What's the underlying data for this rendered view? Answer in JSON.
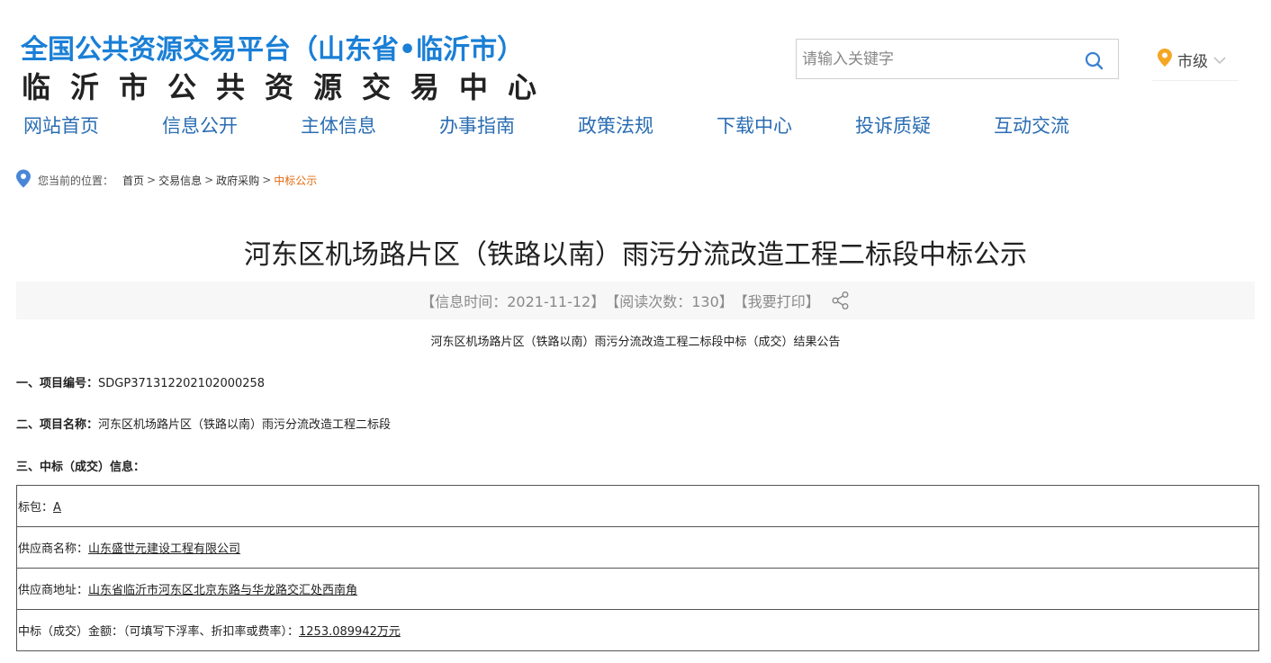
{
  "header": {
    "site_title": "全国公共资源交易平台（山东省•临沂市）",
    "site_subtitle": "临沂市公共资源交易中心"
  },
  "search": {
    "placeholder": "请输入关键字"
  },
  "region": {
    "label": "市级"
  },
  "nav": {
    "items": [
      "网站首页",
      "信息公开",
      "主体信息",
      "办事指南",
      "政策法规",
      "下载中心",
      "投诉质疑",
      "互动交流"
    ]
  },
  "breadcrumb": {
    "prefix": "您当前的位置：",
    "items": [
      "首页",
      "交易信息",
      "政府采购",
      "中标公示"
    ]
  },
  "article": {
    "title": "河东区机场路片区（铁路以南）雨污分流改造工程二标段中标公示",
    "meta": {
      "time": "【信息时间：2021-11-12】",
      "views": "【阅读次数：130】",
      "print": "【我要打印】"
    },
    "subtitle": "河东区机场路片区（铁路以南）雨污分流改造工程二标段中标（成交）结果公告",
    "project_number_label": "一、项目编号：",
    "project_number": "SDGP371312202102000258",
    "project_name_label": "二、项目名称：",
    "project_name": "河东区机场路片区（铁路以南）雨污分流改造工程二标段",
    "award_info_label": "三、中标（成交）信息：",
    "table": [
      {
        "label": "标包：",
        "value": "A"
      },
      {
        "label": "供应商名称：",
        "value": "山东盛世元建设工程有限公司"
      },
      {
        "label": "供应商地址：",
        "value": "山东省临沂市河东区北京东路与华龙路交汇处西南角"
      },
      {
        "label": "中标（成交）金额：（可填写下浮率、折扣率或费率）：",
        "value": "1253.089942万元"
      }
    ]
  },
  "colors": {
    "brand_blue": "#1a7fd6",
    "nav_blue": "#2a6db3",
    "active_orange": "#e36a0f",
    "pin_orange": "#f5a623"
  }
}
